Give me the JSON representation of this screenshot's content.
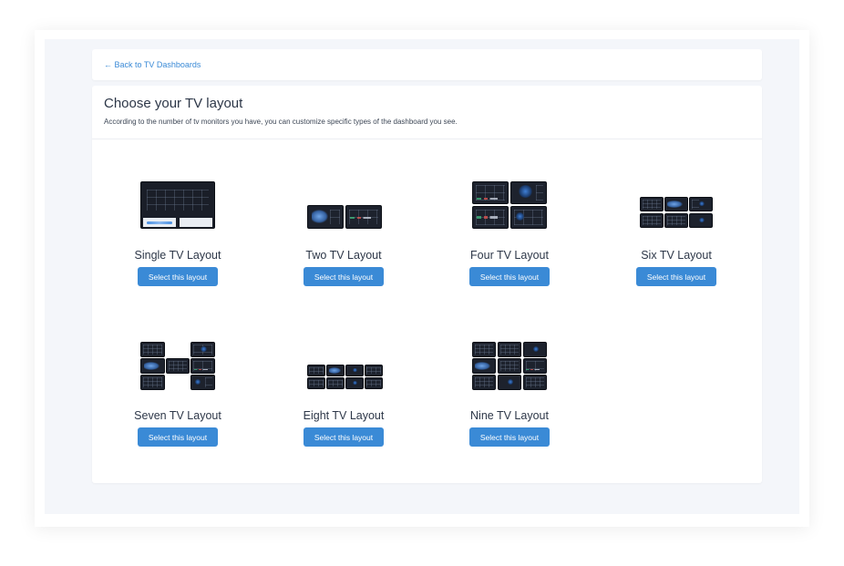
{
  "back": {
    "label": "← Back to TV Dashboards"
  },
  "header": {
    "title": "Choose your TV layout",
    "subtitle": "According to the number of tv monitors you have, you can customize specific types of the dashboard you see."
  },
  "button_label": "Select this layout",
  "colors": {
    "accent": "#3a8ad6",
    "title": "#2d3748",
    "background": "#f4f6fa",
    "screen": "#1d222d"
  },
  "layouts": [
    {
      "label": "Single TV Layout",
      "screens": 1
    },
    {
      "label": "Two TV Layout",
      "screens": 2
    },
    {
      "label": "Four TV Layout",
      "screens": 4
    },
    {
      "label": "Six TV Layout",
      "screens": 6
    },
    {
      "label": "Seven TV Layout",
      "screens": 7
    },
    {
      "label": "Eight TV Layout",
      "screens": 8
    },
    {
      "label": "Nine TV Layout",
      "screens": 9
    }
  ]
}
